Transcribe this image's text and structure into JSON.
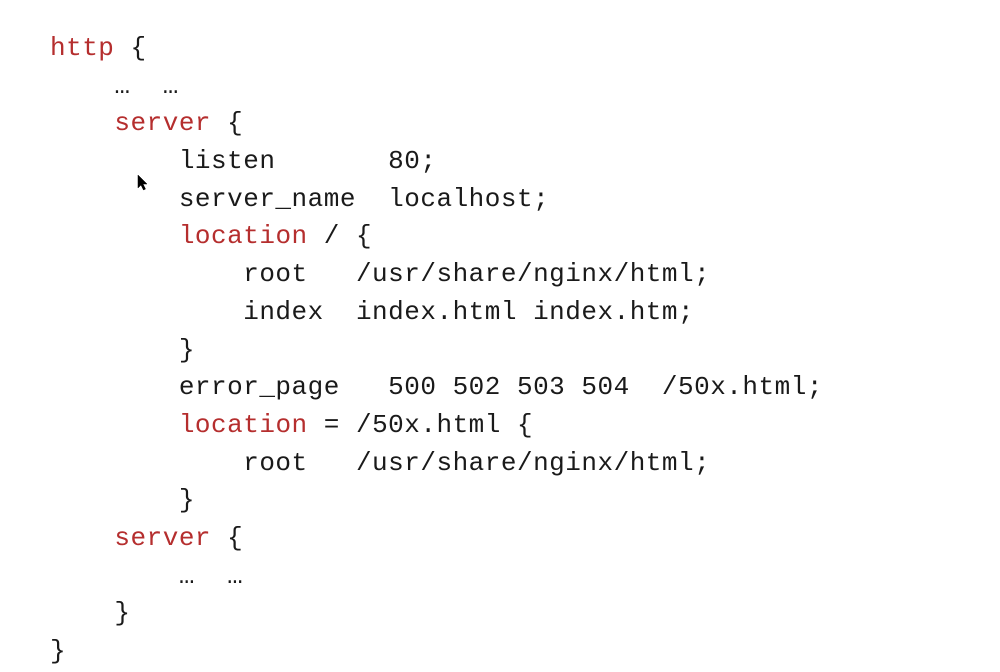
{
  "code": {
    "l01_kw": "http",
    "l01_rest": " {",
    "l02": "    …  …",
    "l03_pad": "    ",
    "l03_kw": "server",
    "l03_rest": " {",
    "l04": "        listen       80;",
    "l05": "        server_name  localhost;",
    "l06": "",
    "l07_pad": "        ",
    "l07_kw": "location",
    "l07_rest": " / {",
    "l08": "            root   /usr/share/nginx/html;",
    "l09": "            index  index.html index.htm;",
    "l10": "        }",
    "l11": "",
    "l12": "        error_page   500 502 503 504  /50x.html;",
    "l13_pad": "        ",
    "l13_kw": "location",
    "l13_rest": " = /50x.html {",
    "l14": "            root   /usr/share/nginx/html;",
    "l15": "        }",
    "l16_pad": "    ",
    "l16_kw": "server",
    "l16_rest": " {",
    "l17": "        …  …",
    "l18": "    }",
    "l19": "}"
  }
}
